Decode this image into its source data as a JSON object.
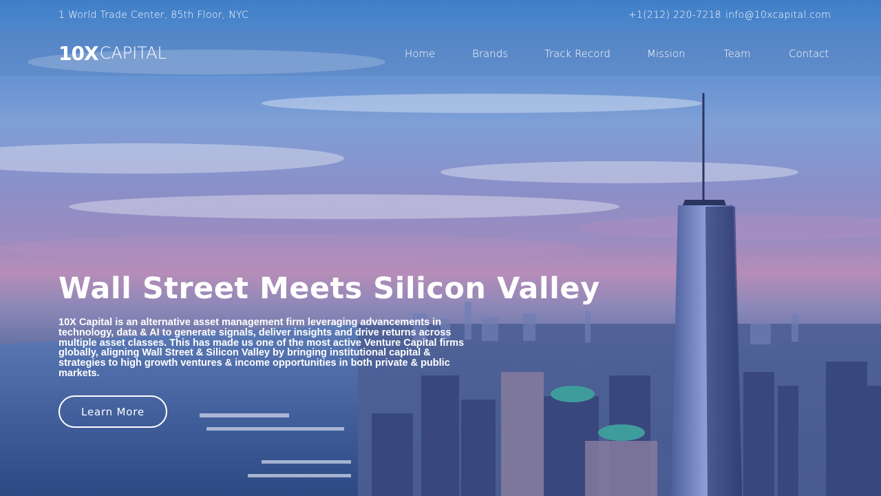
{
  "topbar": {
    "address": "1 World Trade Center, 85th Floor, NYC",
    "phone": "+1(212) 220-7218",
    "email": "info@10xcapital.com"
  },
  "brand": {
    "logo_bold": "10X",
    "logo_light": "CAPITAL"
  },
  "nav": {
    "items": [
      {
        "label": "Home"
      },
      {
        "label": "Brands"
      },
      {
        "label": "Track Record"
      },
      {
        "label": "Mission"
      },
      {
        "label": "Team"
      },
      {
        "label": "Contact"
      }
    ]
  },
  "hero": {
    "title": "Wall Street Meets Silicon Valley",
    "description": "10X Capital is an alternative asset management firm leveraging advancements in technology, data & AI to generate signals, deliver insights and drive returns across multiple asset classes. This has made us one of the most active Venture Capital firms globally, aligning Wall Street & Silicon Valley by bringing institutional capital & strategies to high growth ventures & income opportunities in both private & public markets.",
    "cta_label": "Learn More",
    "background": "new-york-skyline-image"
  },
  "colors": {
    "text": "#ffffff",
    "nav_overlay": "#5a82be"
  }
}
